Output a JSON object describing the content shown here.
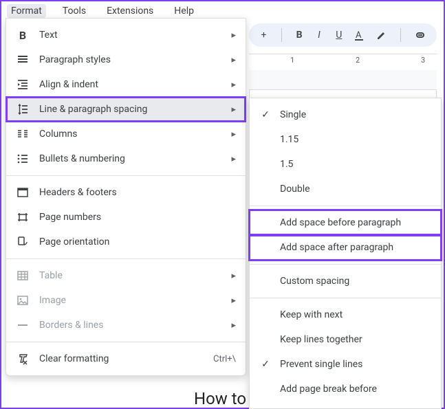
{
  "menubar": {
    "items": [
      "Format",
      "Tools",
      "Extensions",
      "Help"
    ],
    "active_index": 0
  },
  "toolbar": {
    "plus": "+"
  },
  "ruler": {
    "marks": [
      "1",
      "2",
      "3"
    ]
  },
  "format_menu": {
    "items": [
      {
        "icon": "bold-icon",
        "label": "Text",
        "arrow": true
      },
      {
        "icon": "paragraph-styles-icon",
        "label": "Paragraph styles",
        "arrow": true
      },
      {
        "icon": "align-indent-icon",
        "label": "Align & indent",
        "arrow": true
      },
      {
        "icon": "line-spacing-icon",
        "label": "Line & paragraph spacing",
        "arrow": true,
        "highlighted": true
      },
      {
        "icon": "columns-icon",
        "label": "Columns",
        "arrow": true
      },
      {
        "icon": "bullets-icon",
        "label": "Bullets & numbering",
        "arrow": true
      },
      {
        "sep": true
      },
      {
        "icon": "headers-footers-icon",
        "label": "Headers & footers"
      },
      {
        "icon": "page-numbers-icon",
        "label": "Page numbers"
      },
      {
        "icon": "page-orientation-icon",
        "label": "Page orientation"
      },
      {
        "sep": true
      },
      {
        "icon": "table-icon",
        "label": "Table",
        "arrow": true,
        "disabled": true
      },
      {
        "icon": "image-icon",
        "label": "Image",
        "arrow": true,
        "disabled": true
      },
      {
        "icon": "borders-lines-icon",
        "label": "Borders & lines",
        "arrow": true,
        "disabled": true
      },
      {
        "sep": true
      },
      {
        "icon": "clear-formatting-icon",
        "label": "Clear formatting",
        "shortcut": "Ctrl+\\"
      }
    ]
  },
  "spacing_submenu": {
    "items": [
      {
        "label": "Single",
        "checked": true
      },
      {
        "label": "1.15"
      },
      {
        "label": "1.5"
      },
      {
        "label": "Double"
      },
      {
        "sep": true
      },
      {
        "label": "Add space before paragraph",
        "box": true
      },
      {
        "label": "Add space after paragraph",
        "box": true
      },
      {
        "sep": true
      },
      {
        "label": "Custom spacing"
      },
      {
        "sep": true
      },
      {
        "label": "Keep with next"
      },
      {
        "label": "Keep lines together"
      },
      {
        "label": "Prevent single lines",
        "checked": true
      },
      {
        "label": "Add page break before"
      }
    ]
  },
  "doc_body": "How to"
}
